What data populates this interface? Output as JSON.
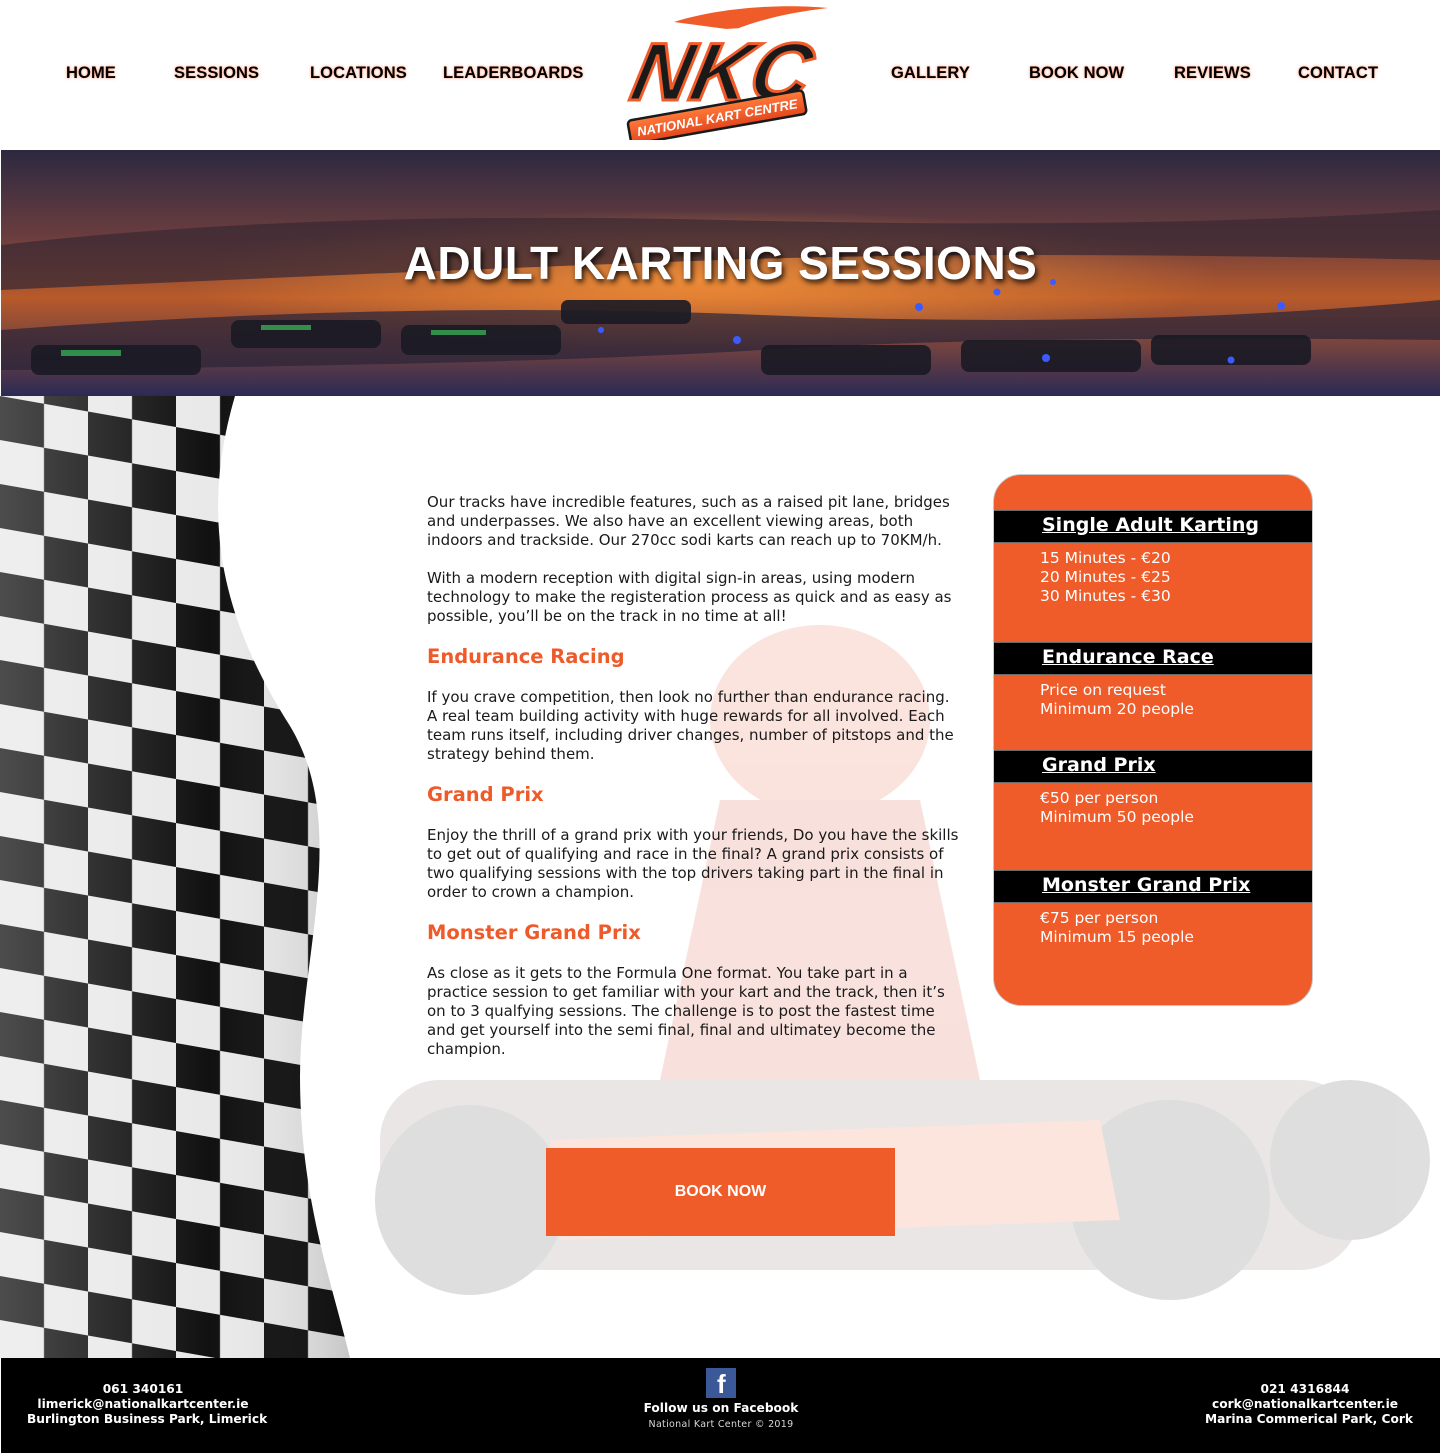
{
  "nav": {
    "home": "HOME",
    "sessions": "SESSIONS",
    "locations": "LOCATIONS",
    "leaderboards": "LEADERBOARDS",
    "gallery": "GALLERY",
    "book_now": "BOOK NOW",
    "reviews": "REVIEWS",
    "contact": "CONTACT"
  },
  "logo": {
    "wordmark": "NKC",
    "tagline": "NATIONAL KART CENTRE"
  },
  "hero": {
    "title": "ADULT KARTING SESSIONS"
  },
  "content": {
    "intro_1": "Our tracks have incredible features, such as a raised pit lane, bridges and underpasses. We also have an excellent viewing areas, both indoors and trackside. Our 270cc sodi karts can reach up to 70KM/h.",
    "intro_2": "With a modern reception with digital sign-in areas, using modern technology to make the registeration process as quick and as easy as possible, you’ll be on the track in no time at all!",
    "endurance_heading": "Endurance Racing",
    "endurance_text": "If you crave competition, then look no further than endurance racing. A real team building activity with huge rewards for all involved. Each team runs itself, including driver changes, number of pitstops and the strategy behind them.",
    "grand_prix_heading": "Grand Prix",
    "grand_prix_text": "Enjoy the thrill of a grand prix with your friends, Do you have the skills to get out of qualifying and race in the final? A grand prix consists of two qualifying sessions with the top drivers taking part in the final in order to crown a champion.",
    "monster_heading": "Monster Grand Prix",
    "monster_text": "As close as it gets to the Formula One format. You take part in a practice session to get familiar with your kart and the track, then it’s on to 3 qualfying sessions. The challenge is to post the fastest time and get yourself into the semi final, final and ultimatey become the champion."
  },
  "pricing": {
    "single": {
      "title": "Single Adult Karting",
      "lines": [
        "15 Minutes - €20",
        "20 Minutes - €25",
        "30 Minutes - €30"
      ]
    },
    "endurance": {
      "title": "Endurance Race",
      "lines": [
        "Price on request",
        "Minimum 20 people"
      ]
    },
    "grand_prix": {
      "title": "Grand Prix",
      "lines": [
        "€50 per person",
        "Minimum 50 people"
      ]
    },
    "monster": {
      "title": "Monster Grand Prix",
      "lines": [
        "€75 per person",
        "Minimum 15 people"
      ]
    }
  },
  "book_button": {
    "label": "BOOK NOW"
  },
  "footer": {
    "limerick": {
      "phone": "061 340161",
      "email": "limerick@nationalkartcenter.ie",
      "address": "Burlington Business Park, Limerick"
    },
    "social": {
      "icon": "facebook-icon",
      "follow": "Follow us on Facebook",
      "copyright": "National Kart Center ©  2019"
    },
    "cork": {
      "phone": "021 4316844",
      "email": "cork@nationalkartcenter.ie",
      "address": "Marina Commerical Park, Cork"
    }
  },
  "colors": {
    "accent": "#ef5b29",
    "footer_bg": "#000000",
    "facebook": "#3b5998"
  }
}
